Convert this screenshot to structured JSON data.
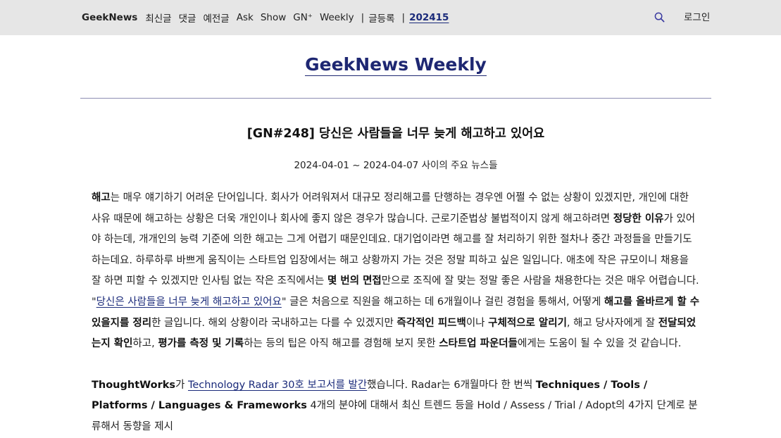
{
  "nav": {
    "brand": "GeekNews",
    "items": [
      "최신글",
      "댓글",
      "예전글",
      "Ask",
      "Show",
      "GN⁺",
      "Weekly"
    ],
    "sep": "|",
    "register": "글등록",
    "issue": "202415",
    "login": "로그인",
    "search_icon": "search-icon"
  },
  "page": {
    "weekly_title": "GeekNews Weekly",
    "issue_title": "[GN#248] 당신은 사람들을 너무 늦게 해고하고 있어요",
    "range": "2024-04-01 ~ 2024-04-07 사이의 주요 뉴스들"
  },
  "para1": [
    {
      "t": "해고",
      "b": true
    },
    {
      "t": "는 매우 얘기하기 어려운 단어입니다. 회사가 어려워져서 대규모 정리해고를 단행하는 경우엔 어쩔 수 없는 상황이 있겠지만, 개인에 대한 사유 때문에 해고하는 상황은 더욱 개인이나 회사에 좋지 않은 경우가 많습니다. 근로기준법상 불법적이지 않게 해고하려면 "
    },
    {
      "t": "정당한 이유",
      "b": true
    },
    {
      "t": "가 있어야 하는데, 개개인의 능력 기준에 의한 해고는 그게 어렵기 때문인데요. 대기업이라면 해고를 잘 처리하기 위한 절차나 중간 과정들을 만들기도 하는데요. 하루하루 바쁘게 움직이는 스타트업 입장에서는 해고 상황까지 가는 것은 정말 피하고 싶은 일입니다. 애초에 작은 규모이니 채용을 잘 하면 피할 수 있겠지만 인사팀 없는 작은 조직에서는 "
    },
    {
      "t": "몇 번의 면접",
      "b": true
    },
    {
      "t": "만으로 조직에 잘 맞는 정말 좋은 사람을 채용한다는 것은 매우 어렵습니다. \""
    },
    {
      "t": "당신은 사람들을 너무 늦게 해고하고 있어요",
      "a": true
    },
    {
      "t": "\" 글은 처음으로 직원을 해고하는 데 6개월이나 걸린 경험을 통해서, 어떻게 "
    },
    {
      "t": "해고를 올바르게 할 수 있을지를 정리",
      "b": true
    },
    {
      "t": "한 글입니다. 해외 상황이라 국내하고는 다를 수 있겠지만 "
    },
    {
      "t": "즉각적인 피드백",
      "b": true
    },
    {
      "t": "이나 "
    },
    {
      "t": "구체적으로 알리기",
      "b": true
    },
    {
      "t": ", 해고 당사자에게 잘 "
    },
    {
      "t": "전달되었는지 확인",
      "b": true
    },
    {
      "t": "하고, "
    },
    {
      "t": "평가를 측정 및 기록",
      "b": true
    },
    {
      "t": "하는 등의 팁은 아직 해고를 경험해 보지 못한 "
    },
    {
      "t": "스타트업 파운더들",
      "b": true
    },
    {
      "t": "에게는 도움이 될 수 있을 것 같습니다."
    }
  ],
  "para2": [
    {
      "t": "ThoughtWorks",
      "b": true
    },
    {
      "t": "가 "
    },
    {
      "t": "Technology Radar 30호 보고서를 발간",
      "a": true
    },
    {
      "t": "했습니다. Radar는 6개월마다 한 번씩 "
    },
    {
      "t": "Techniques / Tools / Platforms / Languages & Frameworks",
      "b": true
    },
    {
      "t": " 4개의 분야에 대해서 최신 트렌드 등을 Hold / Assess / Trial / Adopt의 4가지 단계로 분류해서 동향을 제시"
    }
  ]
}
